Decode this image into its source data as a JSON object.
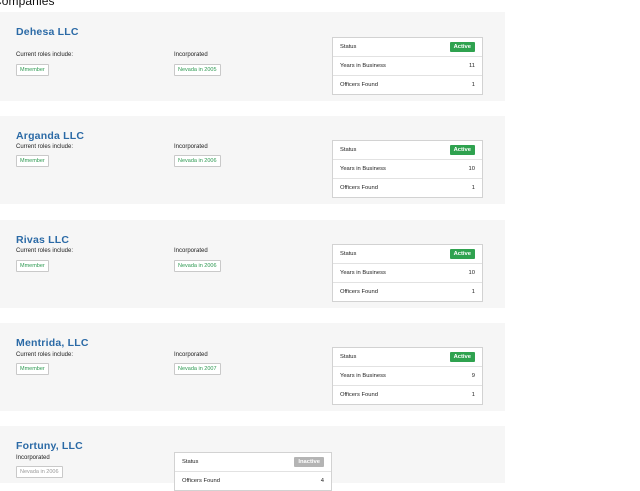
{
  "page": {
    "section_title": "Companies"
  },
  "companies": [
    {
      "name": "Dehesa LLC",
      "roles_label": "Current roles include:",
      "role": "Mmember",
      "incorporated_label": "Incorporated",
      "incorporated": "Nevada in 2005",
      "status_label": "Status",
      "status": "Active",
      "years_label": "Years in Business",
      "years": "11",
      "officers_label": "Officers Found",
      "officers": "1"
    },
    {
      "name": "Arganda LLC",
      "roles_label": "Current roles include:",
      "role": "Mmember",
      "incorporated_label": "Incorporated",
      "incorporated": "Nevada in 2006",
      "status_label": "Status",
      "status": "Active",
      "years_label": "Years in Business",
      "years": "10",
      "officers_label": "Officers Found",
      "officers": "1"
    },
    {
      "name": "Rivas LLC",
      "roles_label": "Current roles include:",
      "role": "Mmember",
      "incorporated_label": "Incorporated",
      "incorporated": "Nevada in 2006",
      "status_label": "Status",
      "status": "Active",
      "years_label": "Years in Business",
      "years": "10",
      "officers_label": "Officers Found",
      "officers": "1"
    },
    {
      "name": "Mentrida, LLC",
      "roles_label": "Current roles include:",
      "role": "Mmember",
      "incorporated_label": "Incorporated",
      "incorporated": "Nevada in 2007",
      "status_label": "Status",
      "status": "Active",
      "years_label": "Years in Business",
      "years": "9",
      "officers_label": "Officers Found",
      "officers": "1"
    },
    {
      "name": "Fortuny, LLC",
      "incorporated_label": "Incorporated",
      "incorporated": "Nevada in 2006",
      "status_label": "Status",
      "status": "Inactive",
      "officers_label": "Officers Found",
      "officers": "4"
    }
  ],
  "colors": {
    "company_name": "#2b6aa6",
    "active_badge": "#2fa24f",
    "inactive_badge": "#b4b4b4",
    "tag_text": "#2e9a52",
    "card_background": "#f6f6f6"
  }
}
